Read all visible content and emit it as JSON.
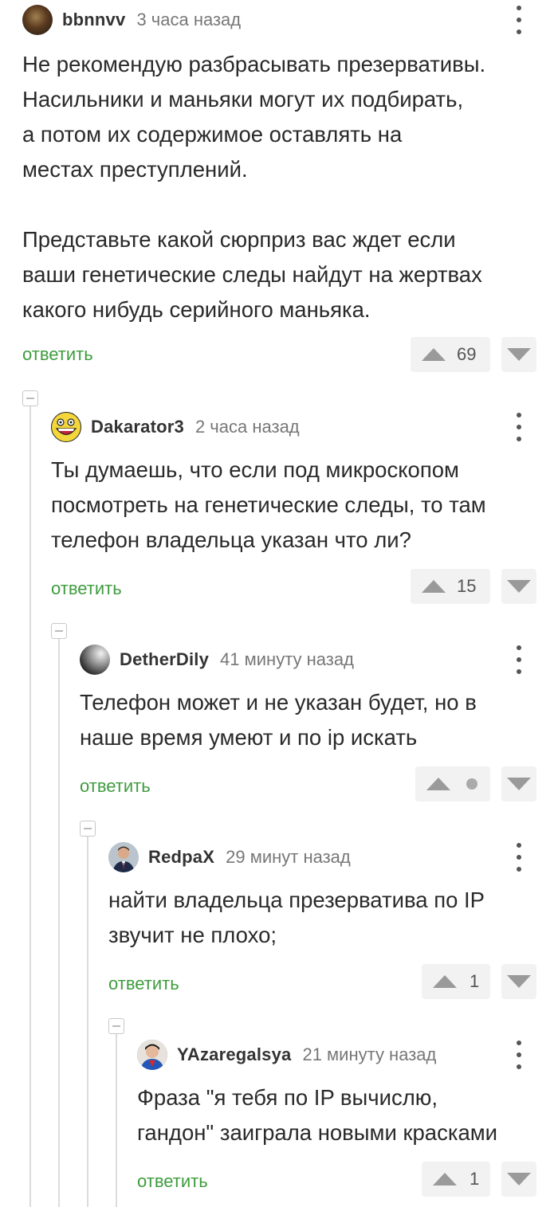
{
  "comments": [
    {
      "author": "bbnnvv",
      "time": "3 часа назад",
      "text": "Не рекомендую разбрасывать презервативы.\nНасильники и маньяки могут их подбирать,\nа потом их содержимое оставлять на\nместах преступлений.\n\nПредставьте какой сюрприз вас ждет если\nваши генетические следы найдут на жертвах\nкакого нибудь серийного маньяка.",
      "reply_label": "ответить",
      "score": "69"
    },
    {
      "author": "Dakarator3",
      "time": "2 часа назад",
      "text": "Ты думаешь, что если под микроскопом\nпосмотреть на генетические следы, то там\nтелефон владельца указан что ли?",
      "reply_label": "ответить",
      "score": "15"
    },
    {
      "author": "DetherDily",
      "time": "41 минуту назад",
      "text": "Телефон может и не указан будет, но в\nнаше время умеют и по ip искать",
      "reply_label": "ответить",
      "score": ""
    },
    {
      "author": "RedpaX",
      "time": "29 минут назад",
      "text": "найти владельца презерватива по IP\nзвучит не плохо;",
      "reply_label": "ответить",
      "score": "1"
    },
    {
      "author": "YAzaregalsya",
      "time": "21 минуту назад",
      "text": "Фраза \"я тебя по IP вычислю,\nгандон\" заиграла новыми красками",
      "reply_label": "ответить",
      "score": "1"
    }
  ],
  "colors": {
    "reply": "#3f9c3f",
    "vote_bg": "#f2f2f2",
    "arrow": "#9a9a9a"
  },
  "icons": [
    "avatar",
    "more-vertical-icon",
    "upvote-arrow-icon",
    "downvote-arrow-icon",
    "collapse-thread-icon",
    "score-placeholder-dot"
  ]
}
